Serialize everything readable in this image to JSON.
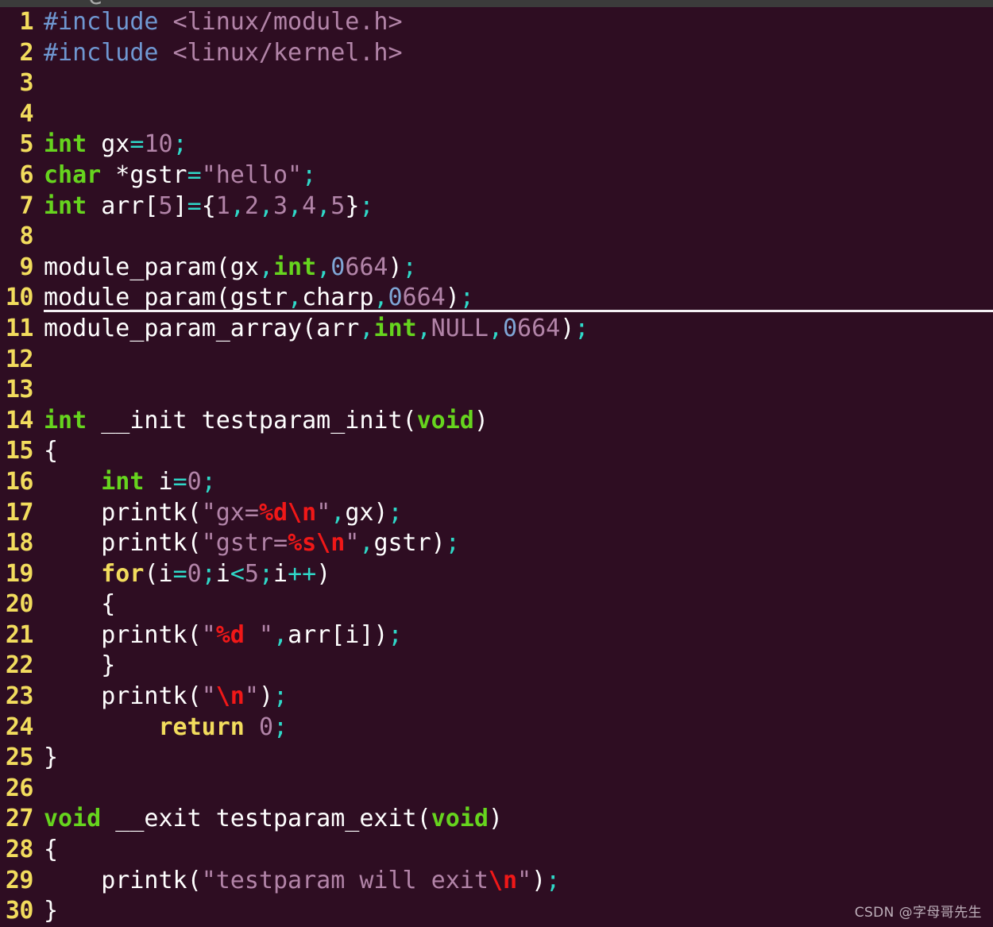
{
  "editor": {
    "background_color": "#2e0d22",
    "gutter_color": "#f2dc5d",
    "default_text_color": "#ffffff",
    "cursor_line_number": 10,
    "top_strip_ghost": "  _e_   _ _",
    "first_visible_line": 1,
    "last_visible_line": 30
  },
  "palette": {
    "preprocessor": "#6f97d1",
    "header_path": "#b284a8",
    "type_keyword": "#66d41e",
    "statement_keyword": "#f2dc5d",
    "constant": "#b284a8",
    "octal_prefix": "#7fa6d6",
    "string": "#b284a8",
    "format_escape": "#f01818",
    "operator": "#2fd8c8",
    "plain": "#ffffff",
    "cursor_underline": "#f4f0f4"
  },
  "watermark": {
    "text": "CSDN @字母哥先生"
  },
  "lines": [
    {
      "num": "1",
      "text": "#include <linux/module.h>"
    },
    {
      "num": "2",
      "text": "#include <linux/kernel.h>"
    },
    {
      "num": "3",
      "text": ""
    },
    {
      "num": "4",
      "text": ""
    },
    {
      "num": "5",
      "text": "int gx=10;"
    },
    {
      "num": "6",
      "text": "char *gstr=\"hello\";"
    },
    {
      "num": "7",
      "text": "int arr[5]={1,2,3,4,5};"
    },
    {
      "num": "8",
      "text": ""
    },
    {
      "num": "9",
      "text": "module_param(gx,int,0664);"
    },
    {
      "num": "10",
      "text": "module_param(gstr,charp,0664);"
    },
    {
      "num": "11",
      "text": "module_param_array(arr,int,NULL,0664);"
    },
    {
      "num": "12",
      "text": ""
    },
    {
      "num": "13",
      "text": ""
    },
    {
      "num": "14",
      "text": "int __init testparam_init(void)"
    },
    {
      "num": "15",
      "text": "{"
    },
    {
      "num": "16",
      "text": "    int i=0;"
    },
    {
      "num": "17",
      "text": "    printk(\"gx=%d\\n\",gx);"
    },
    {
      "num": "18",
      "text": "    printk(\"gstr=%s\\n\",gstr);"
    },
    {
      "num": "19",
      "text": "    for(i=0;i<5;i++)"
    },
    {
      "num": "20",
      "text": "    {"
    },
    {
      "num": "21",
      "text": "    printk(\"%d \",arr[i]);"
    },
    {
      "num": "22",
      "text": "    }"
    },
    {
      "num": "23",
      "text": "    printk(\"\\n\");"
    },
    {
      "num": "24",
      "text": "        return 0;"
    },
    {
      "num": "25",
      "text": "}"
    },
    {
      "num": "26",
      "text": ""
    },
    {
      "num": "27",
      "text": "void __exit testparam_exit(void)"
    },
    {
      "num": "28",
      "text": "{"
    },
    {
      "num": "29",
      "text": "    printk(\"testparam will exit\\n\");"
    },
    {
      "num": "30",
      "text": "}"
    }
  ],
  "tokens": [
    [
      {
        "c": "t-pre",
        "s": "#include"
      },
      {
        "c": "t-plain",
        "s": " "
      },
      {
        "c": "t-header",
        "s": "<linux/module.h>"
      }
    ],
    [
      {
        "c": "t-pre",
        "s": "#include"
      },
      {
        "c": "t-plain",
        "s": " "
      },
      {
        "c": "t-header",
        "s": "<linux/kernel.h>"
      }
    ],
    [],
    [],
    [
      {
        "c": "t-type",
        "s": "int"
      },
      {
        "c": "t-plain",
        "s": " gx"
      },
      {
        "c": "t-op",
        "s": "="
      },
      {
        "c": "t-const",
        "s": "10"
      },
      {
        "c": "t-op",
        "s": ";"
      }
    ],
    [
      {
        "c": "t-type",
        "s": "char"
      },
      {
        "c": "t-plain",
        "s": " *gstr"
      },
      {
        "c": "t-op",
        "s": "="
      },
      {
        "c": "t-string",
        "s": "\"hello\""
      },
      {
        "c": "t-op",
        "s": ";"
      }
    ],
    [
      {
        "c": "t-type",
        "s": "int"
      },
      {
        "c": "t-plain",
        "s": " arr["
      },
      {
        "c": "t-const",
        "s": "5"
      },
      {
        "c": "t-plain",
        "s": "]"
      },
      {
        "c": "t-op",
        "s": "="
      },
      {
        "c": "t-delim",
        "s": "{"
      },
      {
        "c": "t-const",
        "s": "1"
      },
      {
        "c": "t-op",
        "s": ","
      },
      {
        "c": "t-const",
        "s": "2"
      },
      {
        "c": "t-op",
        "s": ","
      },
      {
        "c": "t-const",
        "s": "3"
      },
      {
        "c": "t-op",
        "s": ","
      },
      {
        "c": "t-const",
        "s": "4"
      },
      {
        "c": "t-op",
        "s": ","
      },
      {
        "c": "t-const",
        "s": "5"
      },
      {
        "c": "t-delim",
        "s": "}"
      },
      {
        "c": "t-op",
        "s": ";"
      }
    ],
    [],
    [
      {
        "c": "t-plain",
        "s": "module_param(gx"
      },
      {
        "c": "t-op",
        "s": ","
      },
      {
        "c": "t-type",
        "s": "int"
      },
      {
        "c": "t-op",
        "s": ","
      },
      {
        "c": "t-num0",
        "s": "0"
      },
      {
        "c": "t-const",
        "s": "664"
      },
      {
        "c": "t-plain",
        "s": ")"
      },
      {
        "c": "t-op",
        "s": ";"
      }
    ],
    [
      {
        "c": "t-plain",
        "s": "module_param(gstr"
      },
      {
        "c": "t-op",
        "s": ","
      },
      {
        "c": "t-plain",
        "s": "charp"
      },
      {
        "c": "t-op",
        "s": ","
      },
      {
        "c": "t-num0",
        "s": "0"
      },
      {
        "c": "t-const",
        "s": "664"
      },
      {
        "c": "t-plain",
        "s": ")"
      },
      {
        "c": "t-op",
        "s": ";"
      }
    ],
    [
      {
        "c": "t-plain",
        "s": "module_param_array(arr"
      },
      {
        "c": "t-op",
        "s": ","
      },
      {
        "c": "t-type",
        "s": "int"
      },
      {
        "c": "t-op",
        "s": ","
      },
      {
        "c": "t-const",
        "s": "NULL"
      },
      {
        "c": "t-op",
        "s": ","
      },
      {
        "c": "t-num0",
        "s": "0"
      },
      {
        "c": "t-const",
        "s": "664"
      },
      {
        "c": "t-plain",
        "s": ")"
      },
      {
        "c": "t-op",
        "s": ";"
      }
    ],
    [],
    [],
    [
      {
        "c": "t-type",
        "s": "int"
      },
      {
        "c": "t-plain",
        "s": " __init testparam_init("
      },
      {
        "c": "t-type",
        "s": "void"
      },
      {
        "c": "t-plain",
        "s": ")"
      }
    ],
    [
      {
        "c": "t-delim",
        "s": "{"
      }
    ],
    [
      {
        "c": "t-plain",
        "s": "    "
      },
      {
        "c": "t-type",
        "s": "int"
      },
      {
        "c": "t-plain",
        "s": " i"
      },
      {
        "c": "t-op",
        "s": "="
      },
      {
        "c": "t-const",
        "s": "0"
      },
      {
        "c": "t-op",
        "s": ";"
      }
    ],
    [
      {
        "c": "t-plain",
        "s": "    printk("
      },
      {
        "c": "t-string",
        "s": "\"gx="
      },
      {
        "c": "t-special",
        "s": "%d\\n"
      },
      {
        "c": "t-string",
        "s": "\""
      },
      {
        "c": "t-op",
        "s": ","
      },
      {
        "c": "t-plain",
        "s": "gx)"
      },
      {
        "c": "t-op",
        "s": ";"
      }
    ],
    [
      {
        "c": "t-plain",
        "s": "    printk("
      },
      {
        "c": "t-string",
        "s": "\"gstr="
      },
      {
        "c": "t-special",
        "s": "%s\\n"
      },
      {
        "c": "t-string",
        "s": "\""
      },
      {
        "c": "t-op",
        "s": ","
      },
      {
        "c": "t-plain",
        "s": "gstr)"
      },
      {
        "c": "t-op",
        "s": ";"
      }
    ],
    [
      {
        "c": "t-plain",
        "s": "    "
      },
      {
        "c": "t-stmt",
        "s": "for"
      },
      {
        "c": "t-plain",
        "s": "(i"
      },
      {
        "c": "t-op",
        "s": "="
      },
      {
        "c": "t-const",
        "s": "0"
      },
      {
        "c": "t-op",
        "s": ";"
      },
      {
        "c": "t-plain",
        "s": "i"
      },
      {
        "c": "t-op",
        "s": "<"
      },
      {
        "c": "t-const",
        "s": "5"
      },
      {
        "c": "t-op",
        "s": ";"
      },
      {
        "c": "t-plain",
        "s": "i"
      },
      {
        "c": "t-op",
        "s": "++"
      },
      {
        "c": "t-plain",
        "s": ")"
      }
    ],
    [
      {
        "c": "t-plain",
        "s": "    "
      },
      {
        "c": "t-delim",
        "s": "{"
      }
    ],
    [
      {
        "c": "t-plain",
        "s": "    printk("
      },
      {
        "c": "t-string",
        "s": "\""
      },
      {
        "c": "t-special",
        "s": "%d"
      },
      {
        "c": "t-string",
        "s": " \""
      },
      {
        "c": "t-op",
        "s": ","
      },
      {
        "c": "t-plain",
        "s": "arr[i])"
      },
      {
        "c": "t-op",
        "s": ";"
      }
    ],
    [
      {
        "c": "t-plain",
        "s": "    "
      },
      {
        "c": "t-delim",
        "s": "}"
      }
    ],
    [
      {
        "c": "t-plain",
        "s": "    printk("
      },
      {
        "c": "t-string",
        "s": "\""
      },
      {
        "c": "t-special",
        "s": "\\n"
      },
      {
        "c": "t-string",
        "s": "\""
      },
      {
        "c": "t-plain",
        "s": ")"
      },
      {
        "c": "t-op",
        "s": ";"
      }
    ],
    [
      {
        "c": "t-plain",
        "s": "        "
      },
      {
        "c": "t-stmt",
        "s": "return"
      },
      {
        "c": "t-plain",
        "s": " "
      },
      {
        "c": "t-const",
        "s": "0"
      },
      {
        "c": "t-op",
        "s": ";"
      }
    ],
    [
      {
        "c": "t-delim",
        "s": "}"
      }
    ],
    [],
    [
      {
        "c": "t-type",
        "s": "void"
      },
      {
        "c": "t-plain",
        "s": " __exit testparam_exit("
      },
      {
        "c": "t-type",
        "s": "void"
      },
      {
        "c": "t-plain",
        "s": ")"
      }
    ],
    [
      {
        "c": "t-delim",
        "s": "{"
      }
    ],
    [
      {
        "c": "t-plain",
        "s": "    printk("
      },
      {
        "c": "t-string",
        "s": "\"testparam will exit"
      },
      {
        "c": "t-special",
        "s": "\\n"
      },
      {
        "c": "t-string",
        "s": "\""
      },
      {
        "c": "t-plain",
        "s": ")"
      },
      {
        "c": "t-op",
        "s": ";"
      }
    ],
    [
      {
        "c": "t-delim",
        "s": "}"
      }
    ]
  ]
}
